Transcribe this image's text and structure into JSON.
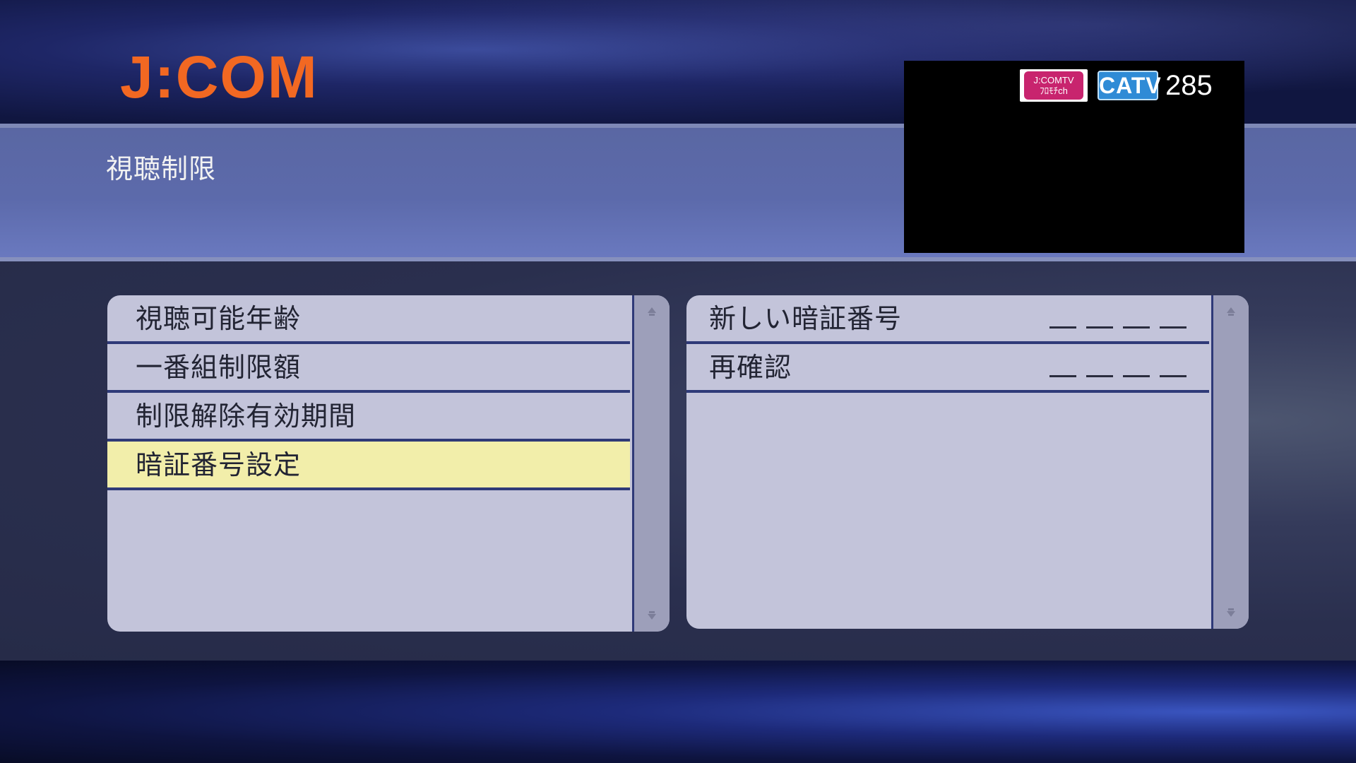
{
  "brand": {
    "logo_text": "J:COM",
    "logo_color": "#f26822"
  },
  "page": {
    "title": "視聴制限"
  },
  "preview": {
    "badge_jcom_line1": "J:COMTV",
    "badge_jcom_line2": "ﾌﾛﾓﾁch",
    "badge_type": "CATV",
    "channel_number": "285"
  },
  "menu": {
    "items": [
      {
        "label": "視聴可能年齢"
      },
      {
        "label": "一番組制限額"
      },
      {
        "label": "制限解除有効期間"
      },
      {
        "label": "暗証番号設定",
        "selected": true
      }
    ]
  },
  "pin_settings": {
    "fields": [
      {
        "label": "新しい暗証番号",
        "value": ""
      },
      {
        "label": "再確認",
        "value": ""
      }
    ]
  },
  "colors": {
    "selected_row": "#f2eeaa",
    "panel_bg": "#c3c4da",
    "divider": "#2f3a78"
  },
  "icons": {
    "scroll_up": "chevron-up-icon",
    "scroll_down": "chevron-down-icon"
  }
}
